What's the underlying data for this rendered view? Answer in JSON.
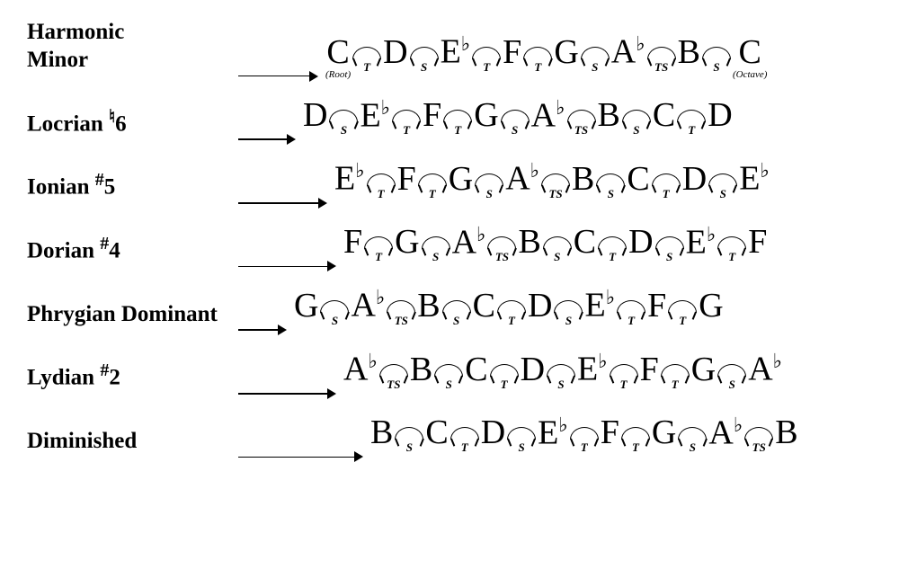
{
  "scales": [
    {
      "name": "Harmonic\nMinor",
      "arrowWidth": 80,
      "indentClass": "indent-0",
      "notes": [
        "C",
        "D",
        "E♭",
        "F",
        "G",
        "A♭",
        "B",
        "C"
      ],
      "noteSubs": [
        "(Root)",
        "",
        "",
        "",
        "",
        "",
        "",
        "(Octave)"
      ],
      "intervals": [
        "T",
        "S",
        "T",
        "T",
        "S",
        "TS",
        "S"
      ]
    },
    {
      "name": "Locrian ♮6",
      "arrowWidth": 55,
      "indentClass": "indent-1",
      "notes": [
        "D",
        "E♭",
        "F",
        "G",
        "A♭",
        "B",
        "C",
        "D"
      ],
      "noteSubs": [
        "",
        "",
        "",
        "",
        "",
        "",
        "",
        ""
      ],
      "intervals": [
        "S",
        "T",
        "T",
        "S",
        "TS",
        "S",
        "T"
      ]
    },
    {
      "name": "Ionian #5",
      "arrowWidth": 90,
      "indentClass": "indent-2",
      "notes": [
        "E♭",
        "F",
        "G",
        "A♭",
        "B",
        "C",
        "D",
        "E♭"
      ],
      "noteSubs": [
        "",
        "",
        "",
        "",
        "",
        "",
        "",
        ""
      ],
      "intervals": [
        "T",
        "T",
        "S",
        "TS",
        "S",
        "T",
        "S"
      ]
    },
    {
      "name": "Dorian #4",
      "arrowWidth": 100,
      "indentClass": "indent-3",
      "notes": [
        "F",
        "G",
        "A♭",
        "B",
        "C",
        "D",
        "E♭",
        "F"
      ],
      "noteSubs": [
        "",
        "",
        "",
        "",
        "",
        "",
        "",
        ""
      ],
      "intervals": [
        "T",
        "S",
        "TS",
        "S",
        "T",
        "S",
        "T"
      ]
    },
    {
      "name": "Phrygian Dominant",
      "arrowWidth": 45,
      "indentClass": "indent-4",
      "notes": [
        "G",
        "A♭",
        "B",
        "C",
        "D",
        "E♭",
        "F",
        "G"
      ],
      "noteSubs": [
        "",
        "",
        "",
        "",
        "",
        "",
        "",
        ""
      ],
      "intervals": [
        "S",
        "TS",
        "S",
        "T",
        "S",
        "T",
        "T"
      ]
    },
    {
      "name": "Lydian #2",
      "arrowWidth": 100,
      "indentClass": "indent-5",
      "notes": [
        "A♭",
        "B",
        "C",
        "D",
        "E♭",
        "F",
        "G",
        "A♭"
      ],
      "noteSubs": [
        "",
        "",
        "",
        "",
        "",
        "",
        "",
        ""
      ],
      "intervals": [
        "TS",
        "S",
        "T",
        "S",
        "T",
        "T",
        "S"
      ]
    },
    {
      "name": "Diminished",
      "arrowWidth": 130,
      "indentClass": "indent-6",
      "notes": [
        "B",
        "C",
        "D",
        "E♭",
        "F",
        "G",
        "A♭",
        "B"
      ],
      "noteSubs": [
        "",
        "",
        "",
        "",
        "",
        "",
        "",
        ""
      ],
      "intervals": [
        "S",
        "T",
        "S",
        "T",
        "T",
        "S",
        "TS"
      ]
    }
  ]
}
